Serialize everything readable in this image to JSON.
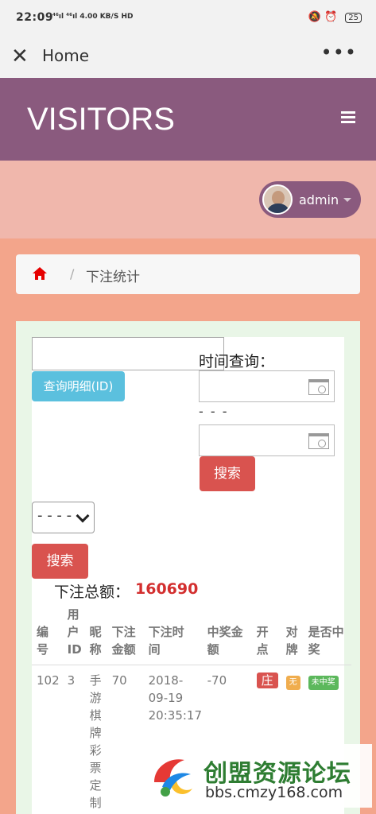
{
  "status_bar": {
    "time": "22:09",
    "signal": "⁴⁶ıl ⁴⁶ıl 4.00 KB/S HD",
    "battery": "25"
  },
  "app_bar": {
    "close_icon": "close-icon",
    "title": "Home",
    "more_icon": "more-icon"
  },
  "brand": {
    "title": "VISITORS",
    "menu_icon": "hamburger-icon"
  },
  "user": {
    "name": "admin"
  },
  "breadcrumb": {
    "home_icon": "home-icon",
    "separator": "/",
    "current": "下注统计"
  },
  "filters": {
    "detail_button": "查询明细(ID)",
    "time_label": "时间查询：",
    "date_separator": "- - -",
    "search_button_1": "搜索",
    "select_value": "- - - -",
    "search_button_2": "搜索"
  },
  "summary": {
    "total_label": "下注总额：",
    "total_value": "160690"
  },
  "table": {
    "headers": [
      "编号",
      "用户ID",
      "昵称",
      "下注金额",
      "下注时间",
      "中奖金额",
      "开点",
      "对牌",
      "是否中奖"
    ],
    "rows": [
      {
        "id": "102",
        "user_id": "3",
        "nickname": "手游棋牌彩票定制",
        "bet": "70",
        "time": "2018-09-19 20:35:17",
        "win": "-70",
        "point": "庄",
        "pair": "无",
        "result": "未中奖"
      }
    ]
  },
  "watermark": {
    "title": "创盟资源论坛",
    "url": "bbs.cmzy168.com"
  },
  "colors": {
    "brand": "#8a5a7e",
    "page_bg": "#f3a58b",
    "danger": "#d9534f",
    "info": "#5bc0de",
    "success": "#5cb85c",
    "warning": "#f0ad4e"
  }
}
